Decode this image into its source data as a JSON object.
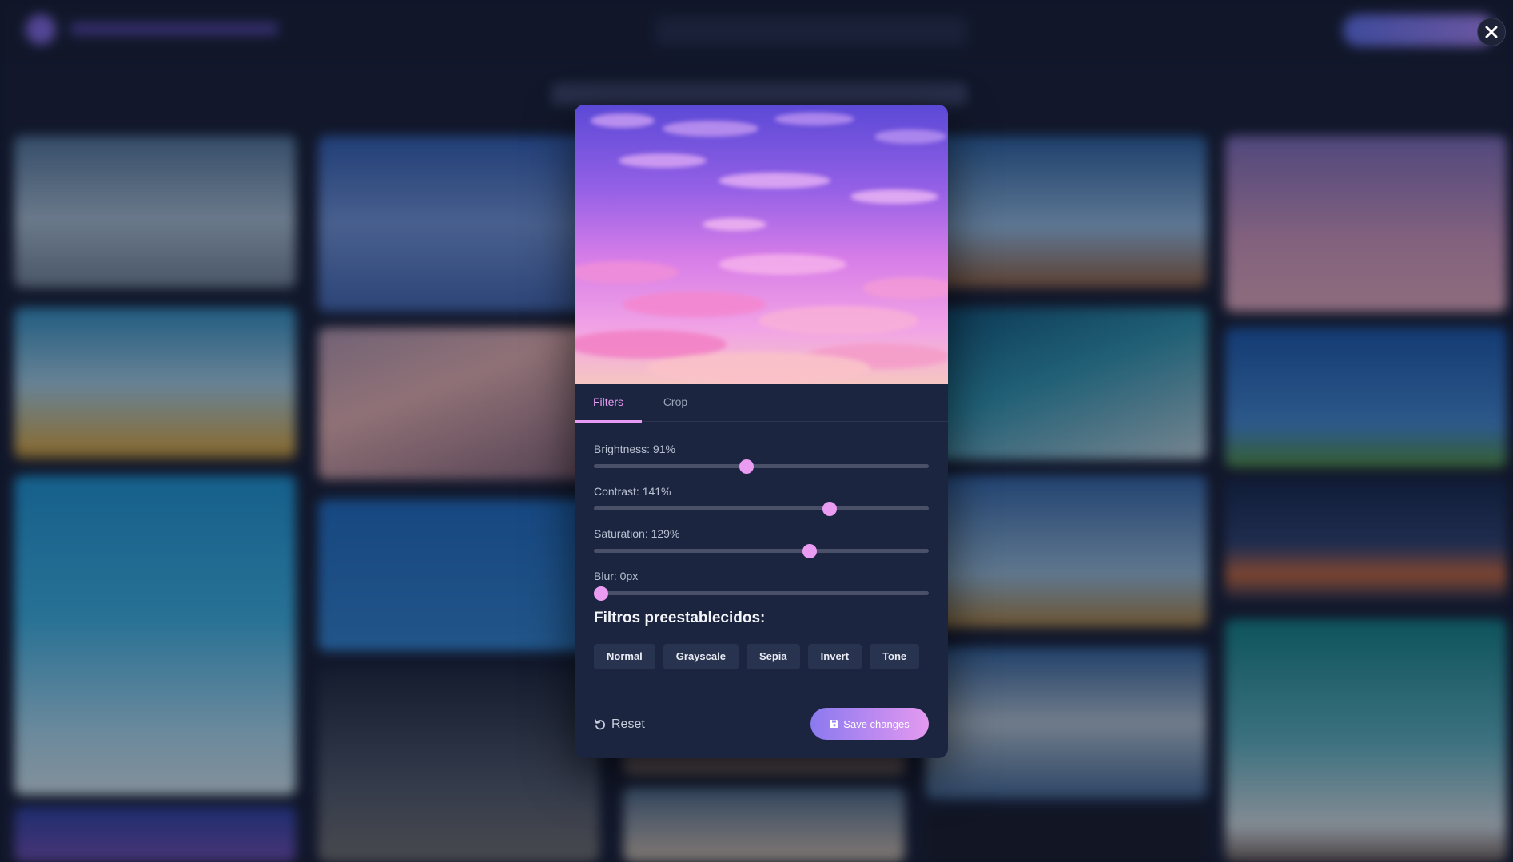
{
  "modal": {
    "tabs": [
      {
        "label": "Filters",
        "active": true
      },
      {
        "label": "Crop",
        "active": false
      }
    ],
    "sliders": [
      {
        "label": "Brightness: 91%",
        "value": 91,
        "min": 0,
        "max": 200
      },
      {
        "label": "Contrast: 141%",
        "value": 141,
        "min": 0,
        "max": 200
      },
      {
        "label": "Saturation: 129%",
        "value": 129,
        "min": 0,
        "max": 200
      },
      {
        "label": "Blur: 0px",
        "value": 0,
        "min": 0,
        "max": 20
      }
    ],
    "presets_title": "Filtros preestablecidos:",
    "presets": [
      "Normal",
      "Grayscale",
      "Sepia",
      "Invert",
      "Tone"
    ],
    "reset_label": "Reset",
    "save_label": "Save changes"
  },
  "icons": {
    "close": "close-icon",
    "reset": "undo-icon",
    "save": "save-icon"
  },
  "colors": {
    "accent": "#e79bf2",
    "modal_bg": "#1b2540",
    "page_bg": "#141a2e"
  }
}
